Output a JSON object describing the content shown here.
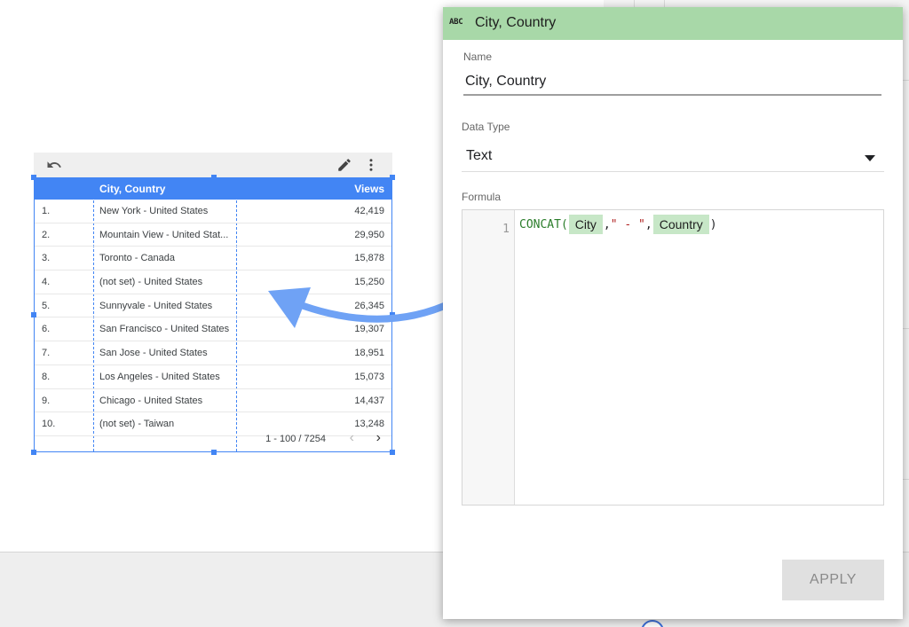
{
  "table": {
    "headers": {
      "city": "City, Country",
      "views": "Views"
    },
    "rows": [
      {
        "index": "1.",
        "city": "New York - United States",
        "views": "42,419"
      },
      {
        "index": "2.",
        "city": "Mountain View - United Stat...",
        "views": "29,950"
      },
      {
        "index": "3.",
        "city": "Toronto - Canada",
        "views": "15,878"
      },
      {
        "index": "4.",
        "city": "(not set) - United States",
        "views": "15,250"
      },
      {
        "index": "5.",
        "city": "Sunnyvale - United States",
        "views": "26,345"
      },
      {
        "index": "6.",
        "city": "San Francisco - United States",
        "views": "19,307"
      },
      {
        "index": "7.",
        "city": "San Jose - United States",
        "views": "18,951"
      },
      {
        "index": "8.",
        "city": "Los Angeles - United States",
        "views": "15,073"
      },
      {
        "index": "9.",
        "city": "Chicago - United States",
        "views": "14,437"
      },
      {
        "index": "10.",
        "city": "(not set) - Taiwan",
        "views": "13,248"
      }
    ],
    "pagination": {
      "range": "1 - 100 / 7254",
      "prev": "‹",
      "next": "›"
    },
    "toolbar": {
      "undo_icon": "undo-icon",
      "edit_icon": "pencil-icon",
      "menu_icon": "more-vert-icon"
    }
  },
  "panel": {
    "type_badge": "ABC",
    "title": "City, Country",
    "name_label": "Name",
    "name_value": "City, Country",
    "data_type_label": "Data Type",
    "data_type_value": "Text",
    "formula_label": "Formula",
    "formula": {
      "line_number": "1",
      "function": "CONCAT(",
      "field1": "City",
      "comma1": ",",
      "string": "\" - \"",
      "comma2": ",",
      "field2": "Country",
      "close": ")"
    },
    "apply_label": "APPLY"
  },
  "colors": {
    "accent": "#4285f4",
    "header_green": "#a8d8a8",
    "chip_green": "#c7e7c7",
    "arrow": "#6fa2f5"
  }
}
